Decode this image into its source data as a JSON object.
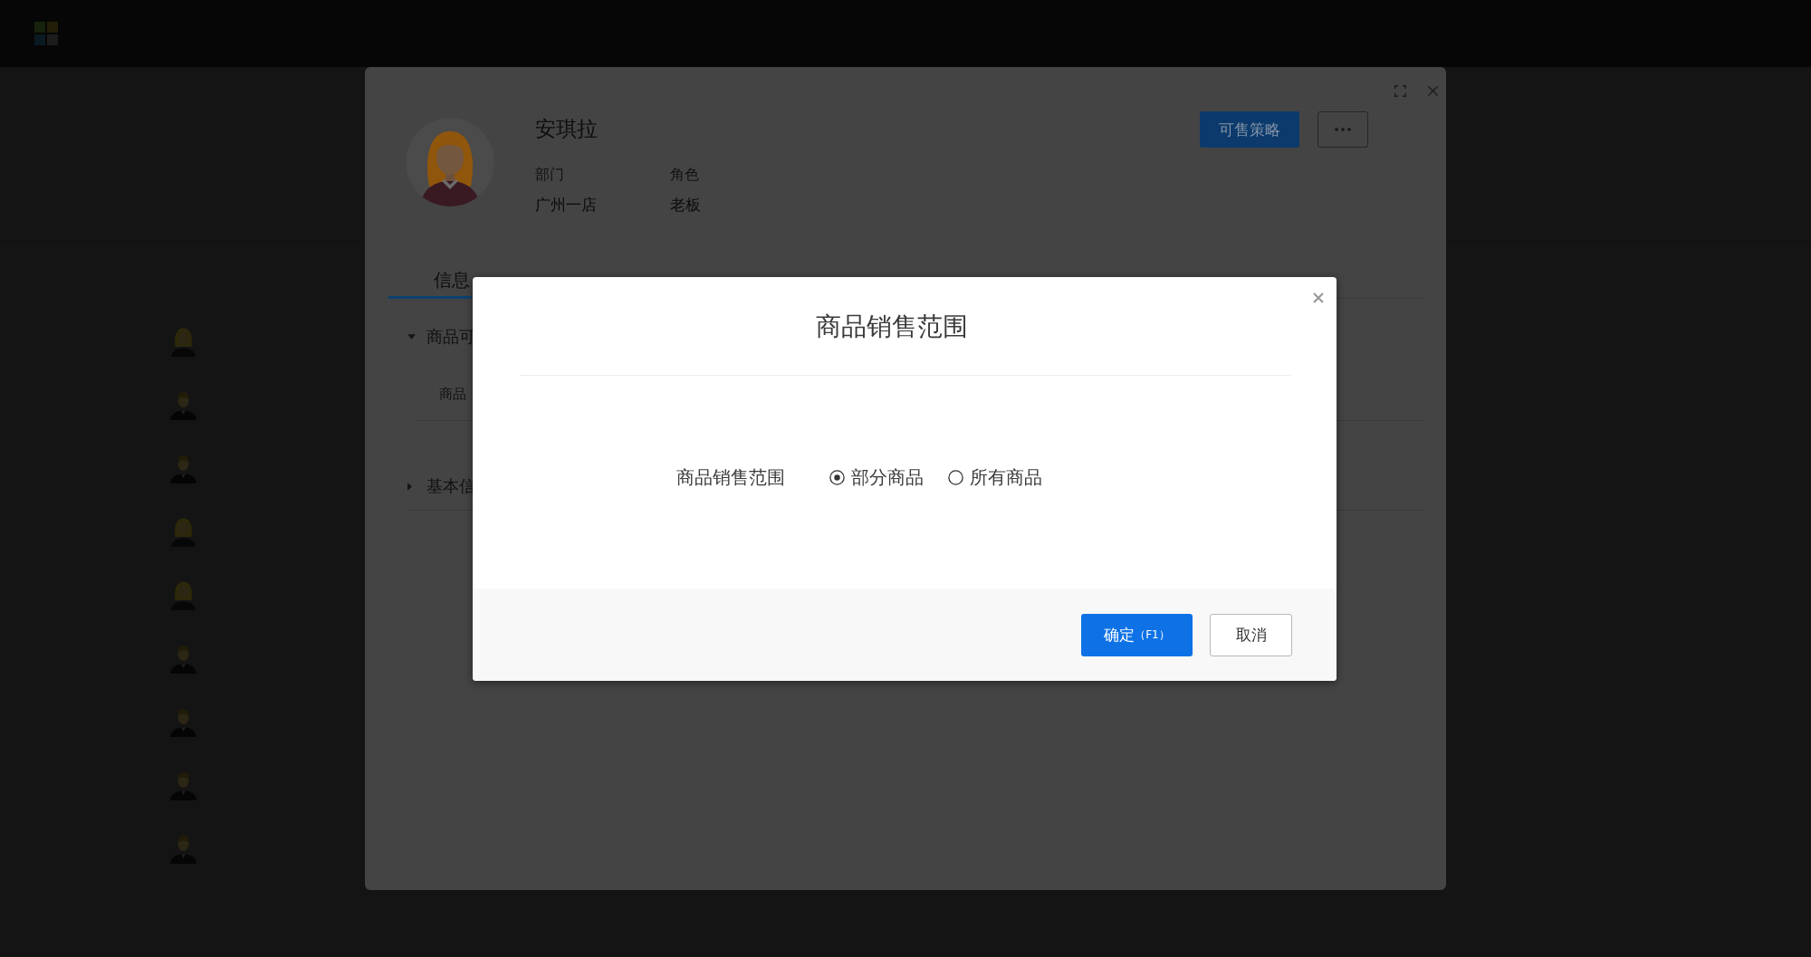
{
  "table": {
    "rows": [
      {
        "kind": "female"
      },
      {
        "kind": "male"
      },
      {
        "kind": "male"
      },
      {
        "kind": "female"
      },
      {
        "kind": "female"
      },
      {
        "kind": "male"
      },
      {
        "kind": "male"
      },
      {
        "kind": "male"
      },
      {
        "kind": "male"
      }
    ]
  },
  "drawer": {
    "name": "安琪拉",
    "fields": [
      {
        "label": "部门",
        "value": "广州一店"
      },
      {
        "label": "角色",
        "value": "老板"
      }
    ],
    "primary_button": "可售策略",
    "tabs": [
      {
        "label": "信息",
        "selected": true
      }
    ],
    "sections": [
      {
        "title": "商品可",
        "expanded": true,
        "rows": [
          {
            "label": "商品"
          }
        ]
      },
      {
        "title": "基本信",
        "expanded": false
      }
    ]
  },
  "dialog": {
    "title": "商品销售范围",
    "field": {
      "label": "商品销售范围",
      "options": [
        {
          "label": "部分商品",
          "selected": true
        },
        {
          "label": "所有商品",
          "selected": false
        }
      ]
    },
    "buttons": [
      {
        "kind": "primary",
        "label": "确定",
        "shortcut": "（F1）"
      },
      {
        "kind": "default",
        "label": "取消"
      }
    ]
  }
}
